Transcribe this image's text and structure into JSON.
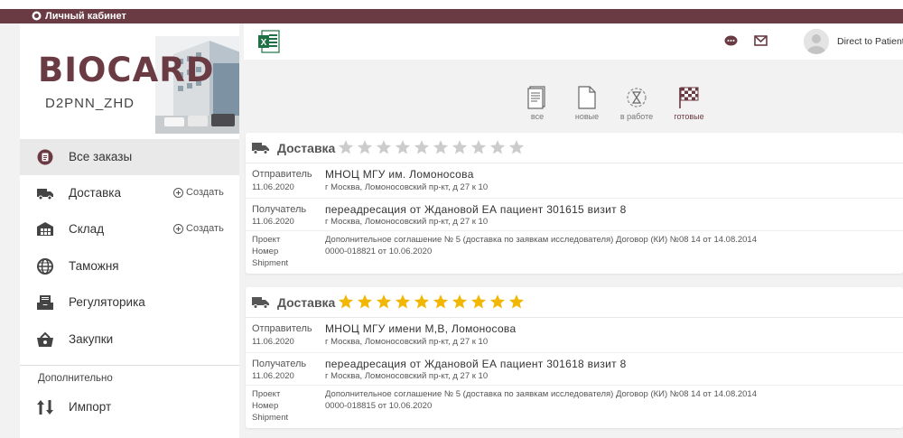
{
  "titlebar": {
    "title": "Личный кабинет"
  },
  "brand": {
    "logo": "BIOCARD",
    "code": "D2PNN_ZHD"
  },
  "nav": {
    "items": [
      {
        "label": "Все заказы",
        "icon": "orders-icon"
      },
      {
        "label": "Доставка",
        "icon": "truck-icon",
        "create": "Создать"
      },
      {
        "label": "Склад",
        "icon": "warehouse-icon",
        "create": "Создать"
      },
      {
        "label": "Таможня",
        "icon": "globe-icon"
      },
      {
        "label": "Регуляторика",
        "icon": "inbox-icon"
      },
      {
        "label": "Закупки",
        "icon": "basket-icon"
      }
    ],
    "section": "Дополнительно",
    "extra": [
      {
        "label": "Импорт",
        "icon": "import-icon"
      }
    ]
  },
  "header": {
    "user_name": "Direct to Patient I"
  },
  "filters": [
    {
      "label": "все",
      "icon": "doc-list-icon"
    },
    {
      "label": "новые",
      "icon": "doc-blank-icon"
    },
    {
      "label": "в работе",
      "icon": "hourglass-icon"
    },
    {
      "label": "готовые",
      "icon": "finish-flag-icon"
    }
  ],
  "colors": {
    "accent": "#6b3b44",
    "star_active": "#f2b705",
    "star_inactive": "#cccccc"
  },
  "cards": [
    {
      "title": "Доставка",
      "rating": 0,
      "rating_max": 10,
      "sender_label": "Отправитель",
      "sender_date": "11.06.2020",
      "sender_name": "МНОЦ МГУ им. Ломоносова",
      "sender_address": "г Москва, Ломоносовский пр-кт, д 27 к 10",
      "recipient_label": "Получатель",
      "recipient_date": "11.06.2020",
      "recipient_name": "переадресация от Ждановой ЕА пациент 301615 визит 8",
      "recipient_address": "г Москва, Ломоносовский пр-кт, д 27 к 10",
      "project_label": "Проект",
      "number_label": "Номер",
      "shipment_label": "Shipment",
      "project_value": "Дополнительное соглашение № 5 (доставка по заявкам исследователя) Договор (КИ) №08 14 от 14.08.2014",
      "number_value": "0000-018821 от 10.06.2020"
    },
    {
      "title": "Доставка",
      "rating": 10,
      "rating_max": 10,
      "sender_label": "Отправитель",
      "sender_date": "11.06.2020",
      "sender_name": "МНОЦ МГУ имени М,В, Ломоносова",
      "sender_address": "г Москва, Ломоносовский пр-кт, д 27 к 10",
      "recipient_label": "Получатель",
      "recipient_date": "11.06.2020",
      "recipient_name": "переадресация от Ждановой ЕА пациент 301618 визит 8",
      "recipient_address": "г Москва, Ломоносовский пр-кт, д 27 к 10",
      "project_label": "Проект",
      "number_label": "Номер",
      "shipment_label": "Shipment",
      "project_value": "Дополнительное соглашение № 5 (доставка по заявкам исследователя) Договор (КИ) №08 14 от 14.08.2014",
      "number_value": "0000-018815 от 10.06.2020"
    }
  ]
}
